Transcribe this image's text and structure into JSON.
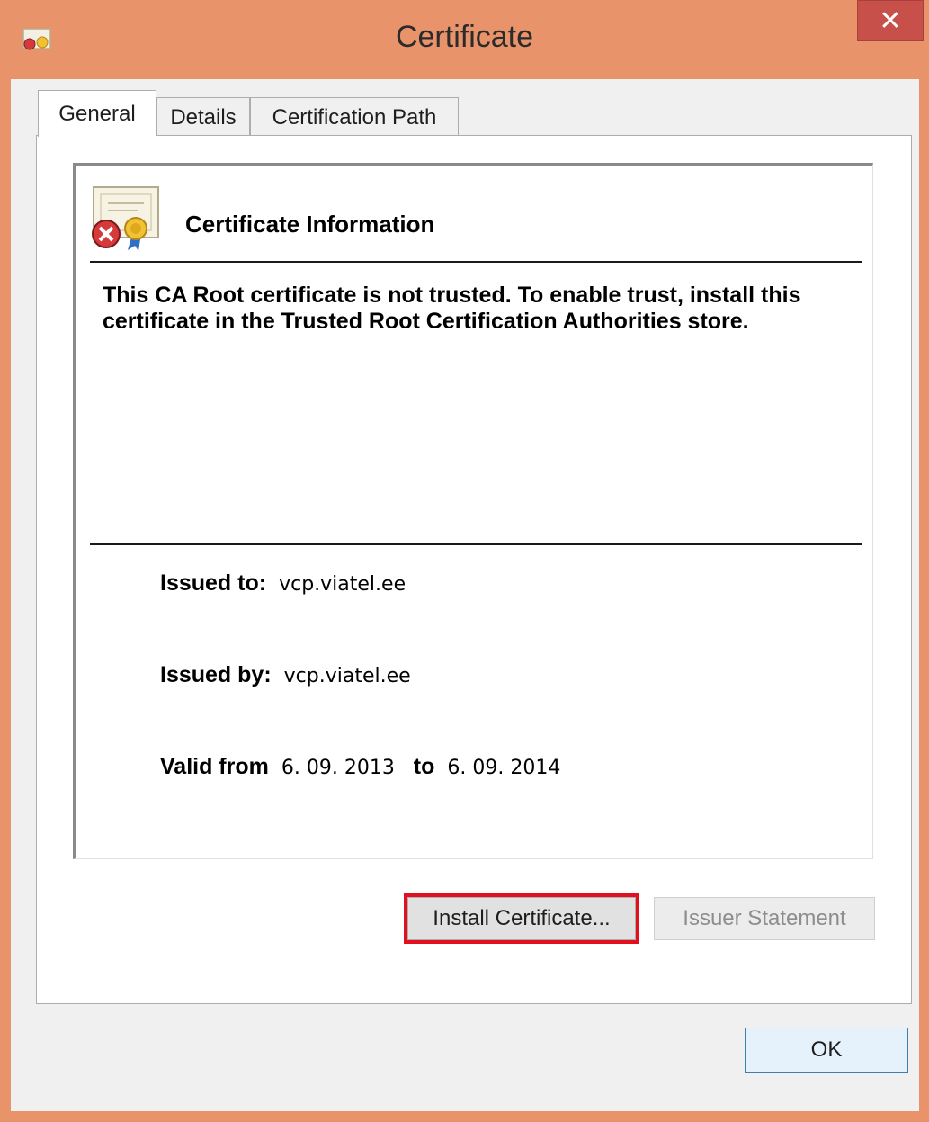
{
  "window": {
    "title": "Certificate",
    "close_symbol": "✕",
    "icon": "certificate-error-icon"
  },
  "tabs": [
    {
      "label": "General",
      "active": true
    },
    {
      "label": "Details",
      "active": false
    },
    {
      "label": "Certification Path",
      "active": false
    }
  ],
  "info": {
    "icon": "certificate-error-icon",
    "heading": "Certificate Information",
    "message": "This CA Root certificate is not trusted. To enable trust, install this certificate in the Trusted Root Certification Authorities store.",
    "issued_to_label": "Issued to:",
    "issued_to_value": "vcp.viatel.ee",
    "issued_by_label": "Issued by:",
    "issued_by_value": "vcp.viatel.ee",
    "valid_from_label": "Valid from",
    "valid_from_value": "6. 09. 2013",
    "valid_to_label": "to",
    "valid_to_value": "6. 09. 2014"
  },
  "buttons": {
    "install": "Install Certificate...",
    "issuer_statement": "Issuer Statement",
    "ok": "OK"
  },
  "colors": {
    "title_bar": "#e9936a",
    "close_button": "#c7504a",
    "highlight": "#e2101f"
  }
}
